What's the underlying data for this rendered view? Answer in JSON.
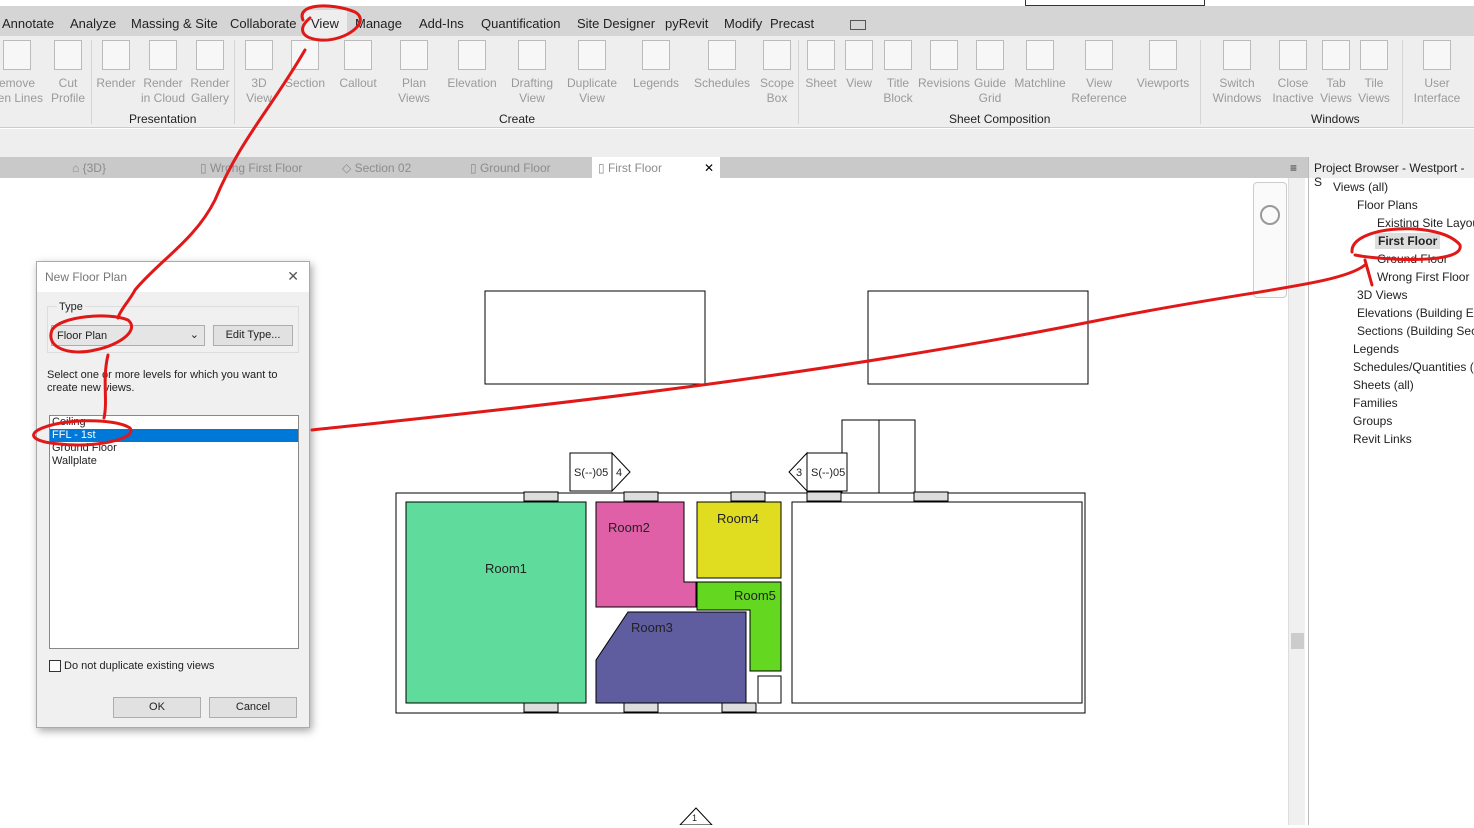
{
  "ribbon_tabs": [
    "Annotate",
    "Analyze",
    "Massing & Site",
    "Collaborate",
    "View",
    "Manage",
    "Add-Ins",
    "Quantification",
    "Site Designer",
    "pyRevit",
    "Modify",
    "Precast"
  ],
  "active_tab": "View",
  "ribbon_buttons": [
    {
      "l1": "emove",
      "l2": "den Lines"
    },
    {
      "l1": "Cut",
      "l2": "Profile"
    },
    {
      "l1": "Render",
      "l2": ""
    },
    {
      "l1": "Render",
      "l2": "in Cloud"
    },
    {
      "l1": "Render",
      "l2": "Gallery"
    },
    {
      "l1": "3D",
      "l2": "View"
    },
    {
      "l1": "Section",
      "l2": ""
    },
    {
      "l1": "Callout",
      "l2": ""
    },
    {
      "l1": "Plan",
      "l2": "Views"
    },
    {
      "l1": "Elevation",
      "l2": ""
    },
    {
      "l1": "Drafting",
      "l2": "View"
    },
    {
      "l1": "Duplicate",
      "l2": "View"
    },
    {
      "l1": "Legends",
      "l2": ""
    },
    {
      "l1": "Schedules",
      "l2": ""
    },
    {
      "l1": "Scope",
      "l2": "Box"
    },
    {
      "l1": "Sheet",
      "l2": ""
    },
    {
      "l1": "View",
      "l2": ""
    },
    {
      "l1": "Title",
      "l2": "Block"
    },
    {
      "l1": "Revisions",
      "l2": ""
    },
    {
      "l1": "Guide",
      "l2": "Grid"
    },
    {
      "l1": "Matchline",
      "l2": ""
    },
    {
      "l1": "View",
      "l2": "Reference"
    },
    {
      "l1": "Viewports",
      "l2": ""
    },
    {
      "l1": "Switch",
      "l2": "Windows"
    },
    {
      "l1": "Close",
      "l2": "Inactive"
    },
    {
      "l1": "Tab",
      "l2": "Views"
    },
    {
      "l1": "Tile",
      "l2": "Views"
    },
    {
      "l1": "User",
      "l2": "Interface"
    }
  ],
  "panels": [
    "Presentation",
    "Create",
    "Sheet Composition",
    "Windows"
  ],
  "view_tabs": [
    "{3D}",
    "Wrong First Floor",
    "Section 02",
    "Ground Floor",
    "First Floor"
  ],
  "close_glyph": "✕",
  "dialog": {
    "title": "New Floor Plan",
    "type_label": "Type",
    "type_value": "Floor Plan",
    "edit_type": "Edit Type...",
    "instructions": "Select one or more levels for which you want to create new views.",
    "levels": [
      "Ceiling",
      "FFL - 1st",
      "Ground Floor",
      "Wallplate"
    ],
    "selected_level": "FFL - 1st",
    "checkbox_label": "Do not duplicate existing views",
    "ok": "OK",
    "cancel": "Cancel"
  },
  "plan": {
    "rooms": [
      "Room1",
      "Room2",
      "Room3",
      "Room4",
      "Room5"
    ],
    "section_tags": [
      "S(--)05",
      "4",
      "3",
      "S(--)05"
    ],
    "elevation_tag": "1"
  },
  "browser": {
    "title": "Project Browser - Westport - S",
    "items": [
      "Views (all)",
      "Floor Plans",
      "Existing Site Layout",
      "First Floor",
      "Ground Floor",
      "Wrong First Floor",
      "3D Views",
      "Elevations (Building El",
      "Sections (Building Sec",
      "Legends",
      "Schedules/Quantities (a",
      "Sheets (all)",
      "Families",
      "Groups",
      "Revit Links"
    ]
  },
  "colors": {
    "room1": "#5fdc9b",
    "room2": "#e060a8",
    "room3": "#5f5c9f",
    "room4": "#e0dc20",
    "room5": "#64d820",
    "annotation": "#e01818",
    "selection": "#0078d7"
  }
}
